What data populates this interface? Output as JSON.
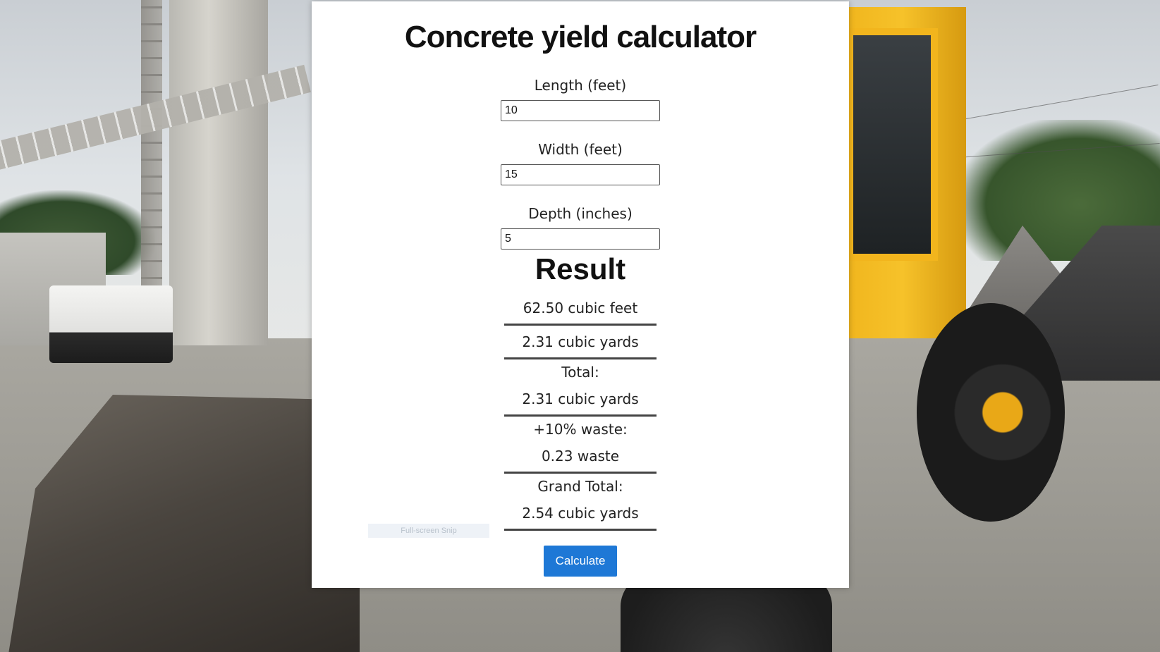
{
  "page": {
    "title": "Concrete yield calculator"
  },
  "form": {
    "length": {
      "label": "Length (feet)",
      "value": "10"
    },
    "width": {
      "label": "Width (feet)",
      "value": "15"
    },
    "depth": {
      "label": "Depth (inches)",
      "value": "5"
    }
  },
  "result": {
    "heading": "Result",
    "cubic_feet": "62.50 cubic feet",
    "cubic_yards": "2.31 cubic yards",
    "total_label": "Total:",
    "total_value": "2.31 cubic yards",
    "waste_label": "+10% waste:",
    "waste_value": "0.23 waste",
    "grand_total_label": "Grand Total:",
    "grand_total_value": "2.54 cubic yards"
  },
  "overlay": {
    "snip_text": "Full-screen Snip"
  },
  "actions": {
    "calculate_label": "Calculate"
  },
  "colors": {
    "button": "#1e78d6",
    "panel": "#ffffff",
    "divider": "#444444"
  }
}
